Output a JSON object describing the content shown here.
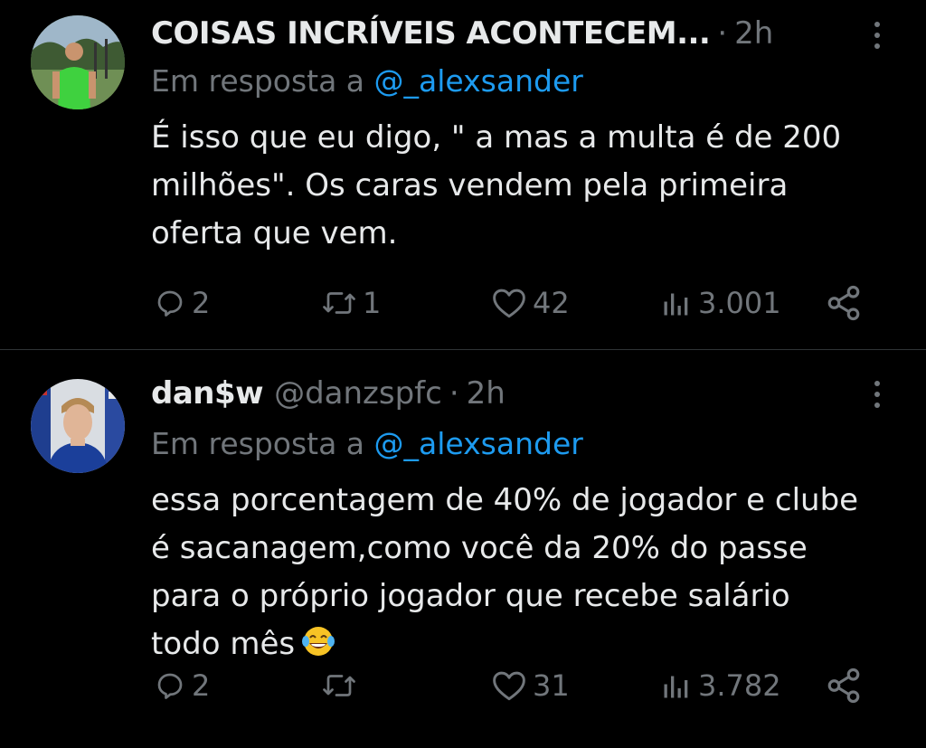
{
  "tweets": [
    {
      "name": "COISAS INCRÍVEIS ACONTECEM...",
      "handle": "",
      "separator": "·",
      "time": "2h",
      "reply_prefix": "Em resposta a",
      "reply_to": "@_alexsander",
      "text_lines": [
        "É isso que eu digo, \" a mas a multa é de 200",
        "milhões\". Os caras vendem pela primeira",
        "oferta que vem."
      ],
      "replies": "2",
      "retweets": "1",
      "likes": "42",
      "views": "3.001",
      "avatar_icon": "avatar-man-green-shirt"
    },
    {
      "name": "dan$w",
      "handle": "@danzspfc",
      "separator": "·",
      "time": "2h",
      "reply_prefix": "Em resposta a",
      "reply_to": "@_alexsander",
      "text_lines": [
        "essa porcentagem de 40% de jogador e clube",
        "é sacanagem,como você da 20% do passe",
        "para o próprio jogador que recebe salário",
        "todo mês"
      ],
      "emoji": "face-with-tears-of-joy",
      "replies": "2",
      "retweets": "",
      "likes": "31",
      "views": "3.782",
      "avatar_icon": "avatar-player-blue-shirt"
    }
  ],
  "colors": {
    "background": "#000000",
    "text": "#e7e9ea",
    "muted": "#71767b",
    "link": "#1d9bf0",
    "divider": "#2f3336"
  }
}
